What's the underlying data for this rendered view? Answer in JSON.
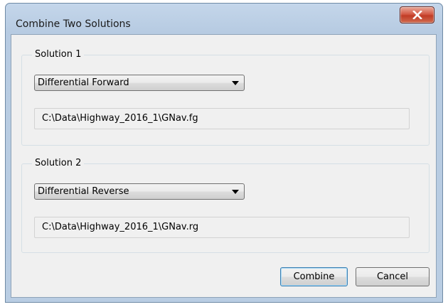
{
  "window": {
    "title": "Combine Two Solutions",
    "close_icon": "close-x-icon"
  },
  "solution1": {
    "label": "Solution 1",
    "selected": "Differential Forward",
    "path": "C:\\Data\\Highway_2016_1\\GNav.fg"
  },
  "solution2": {
    "label": "Solution 2",
    "selected": "Differential Reverse",
    "path": "C:\\Data\\Highway_2016_1\\GNav.rg"
  },
  "buttons": {
    "combine": "Combine",
    "cancel": "Cancel"
  },
  "colors": {
    "close_button": "#c13c26",
    "default_button_border": "#3c7fb1",
    "dialog_background": "#f0f0f0"
  }
}
